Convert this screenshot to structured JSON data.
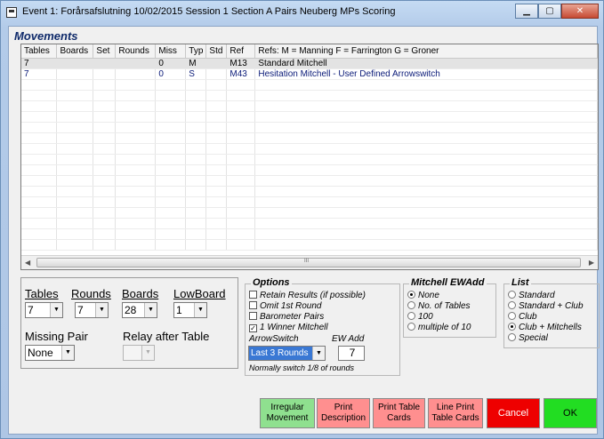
{
  "window": {
    "title": "Event 1:  Forårsafslutning 10/02/2015 Session 1 Section A Pairs Neuberg MPs Scoring"
  },
  "controls": {
    "minimize": "▁",
    "maximize": "▢",
    "close": "✕"
  },
  "movements": {
    "label": "Movements",
    "columns": [
      "Tables",
      "Boards",
      "Set",
      "Rounds",
      "Miss",
      "Typ",
      "Std",
      "Ref",
      "Refs: M = Manning  F = Farrington  G = Groner"
    ],
    "rows": [
      [
        "7",
        "",
        "",
        "",
        "0",
        "M",
        "",
        "M13",
        "Standard Mitchell"
      ],
      [
        "7",
        "",
        "",
        "",
        "0",
        "S",
        "",
        "M43",
        "Hesitation Mitchell - User Defined Arrowswitch"
      ]
    ],
    "scroll_grip": "III"
  },
  "setup": {
    "tables_label": "Tables",
    "tables_value": "7",
    "rounds_label": "Rounds",
    "rounds_value": "7",
    "boards_label": "Boards",
    "boards_value": "28",
    "lowboard_label": "LowBoard",
    "lowboard_value": "1",
    "missing_pair_label": "Missing Pair",
    "missing_pair_value": "None",
    "relay_label": "Relay after Table",
    "relay_value": ""
  },
  "options": {
    "title": "Options",
    "items": [
      {
        "label": "Retain Results (if possible)",
        "checked": false
      },
      {
        "label": "Omit 1st Round",
        "checked": false
      },
      {
        "label": "Barometer Pairs",
        "checked": false
      },
      {
        "label": "1 Winner Mitchell",
        "checked": true
      }
    ],
    "arrowswitch_label": "ArrowSwitch",
    "arrowswitch_value": "Last 3 Rounds",
    "ewadd_label": "EW Add",
    "ewadd_value": "7",
    "note": "Normally switch 1/8 of rounds"
  },
  "mitchell_ewadd": {
    "title": "Mitchell EWAdd",
    "items": [
      "None",
      "No. of Tables",
      "100",
      "multiple of 10"
    ],
    "selected": 0
  },
  "list": {
    "title": "List",
    "items": [
      "Standard",
      "Standard + Club",
      "Club",
      "Club + Mitchells",
      "Special"
    ],
    "selected": 3
  },
  "buttons": {
    "irregular": "Irregular Movement",
    "print_desc": "Print Description",
    "print_cards": "Print Table Cards",
    "line_print": "Line Print Table Cards",
    "cancel": "Cancel",
    "ok": "OK"
  },
  "colors": {
    "green": "#8fe08f",
    "pink": "#ff8f8f",
    "red": "#ee0000",
    "bright_green": "#22dd22"
  }
}
